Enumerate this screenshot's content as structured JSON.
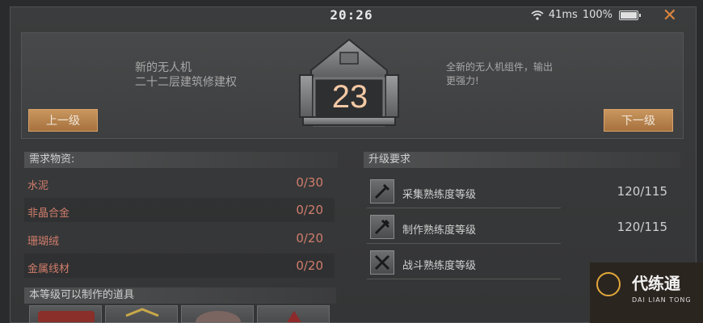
{
  "status": {
    "time": "20:26",
    "ping": "41ms",
    "battery": "100%"
  },
  "header": {
    "left_line1": "新的无人机",
    "left_line2": "二十二层建筑修建权",
    "right_line1": "全新的无人机组件，输出",
    "right_line2": "更强力!",
    "level": "23",
    "prev_label": "上一级",
    "next_label": "下一级"
  },
  "materials": {
    "title": "需求物资:",
    "items": [
      {
        "name": "水泥",
        "count": "0/30"
      },
      {
        "name": "非晶合金",
        "count": "0/20"
      },
      {
        "name": "珊瑚绒",
        "count": "0/20"
      },
      {
        "name": "金属线材",
        "count": "0/20"
      }
    ]
  },
  "requirements": {
    "title": "升级要求",
    "items": [
      {
        "name": "采集熟练度等级",
        "value": "120/115",
        "icon": "gather-icon"
      },
      {
        "name": "制作熟练度等级",
        "value": "120/115",
        "icon": "craft-icon"
      },
      {
        "name": "战斗熟练度等级",
        "value": "",
        "icon": "combat-icon"
      }
    ]
  },
  "craftable": {
    "title": "本等级可以制作的道具"
  },
  "watermark": {
    "title": "代练通",
    "subtitle": "DAI LIAN TONG"
  },
  "colors": {
    "accent": "#d9843f",
    "material_text": "#d07d6c",
    "button": "#b98550"
  }
}
